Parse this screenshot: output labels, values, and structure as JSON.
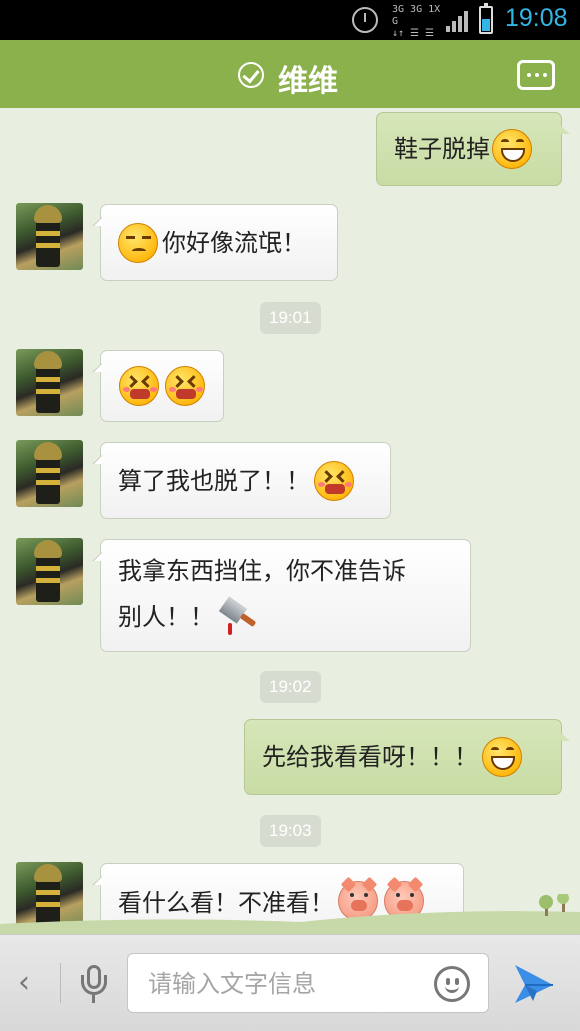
{
  "status_bar": {
    "time": "19:08",
    "network_top": "3G 3G 1X G",
    "network_bottom": "↓↑ ☰ ☰",
    "icons": [
      "alarm-icon",
      "signal-icon",
      "battery-icon"
    ],
    "time_color": "#33b5e5"
  },
  "header": {
    "title": "维维",
    "online_icon": "check-circle-icon",
    "menu_icon": "more-icon",
    "color": "#8ab14c"
  },
  "messages": [
    {
      "side": "out",
      "text": "鞋子脱掉",
      "emoji_after": [
        "grin"
      ]
    },
    {
      "side": "in",
      "text": "你好像流氓！",
      "emoji_before": [
        "smirk"
      ]
    },
    {
      "type": "time",
      "text": "19:01"
    },
    {
      "side": "in",
      "text": "",
      "emoji_after": [
        "grimace",
        "grimace"
      ]
    },
    {
      "side": "in",
      "text": "算了我也脱了！！",
      "emoji_after": [
        "grimace"
      ]
    },
    {
      "side": "in",
      "lines": [
        "我拿东西挡住，你不准告诉",
        "别人！！"
      ],
      "emoji_after": [
        "cleaver"
      ]
    },
    {
      "type": "time",
      "text": "19:02"
    },
    {
      "side": "out",
      "text": "先给我看看呀！！！",
      "emoji_after": [
        "grin"
      ]
    },
    {
      "type": "time",
      "text": "19:03"
    },
    {
      "side": "in",
      "text": "看什么看！不准看！",
      "emoji_after": [
        "pig",
        "pig"
      ]
    }
  ],
  "input_bar": {
    "placeholder": "请输入文字信息",
    "back_label": "‹",
    "icons": [
      "back-icon",
      "microphone-icon",
      "emoji-icon",
      "send-icon"
    ],
    "send_color": "#3a8ee6"
  },
  "colors": {
    "chat_background": "#e9efe0",
    "outgoing_bubble": "#cfe2b0",
    "incoming_bubble": "#ffffff"
  }
}
